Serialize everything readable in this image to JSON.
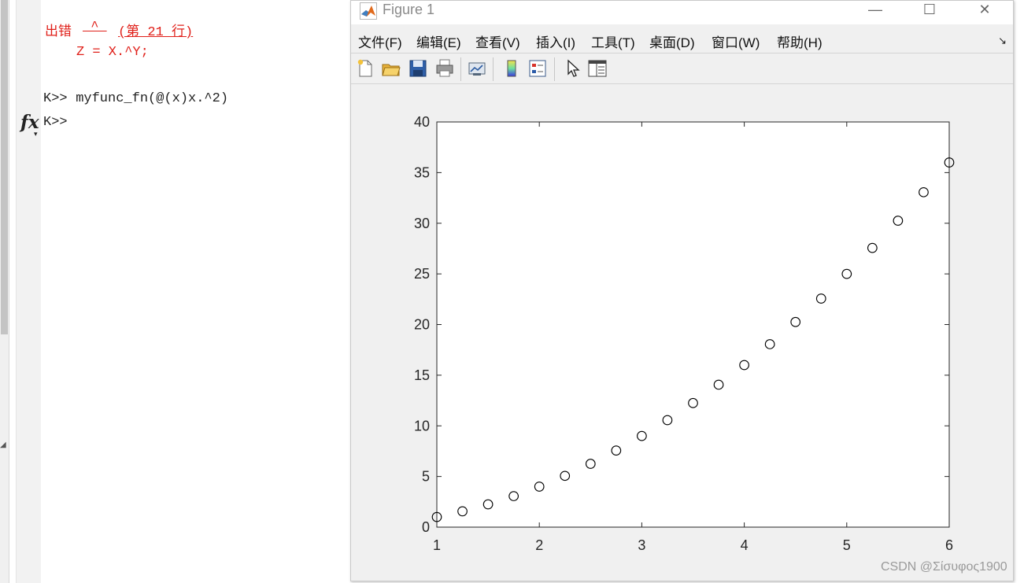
{
  "command_window": {
    "error_prefix": "出错",
    "error_caret": " ^ ",
    "error_location": "(第 21 行)",
    "error_code_line": "Z = X.^Y;",
    "prompt1": "K>>",
    "command1": " myfunc_fn(@(x)x.^2)",
    "prompt2": "K>>",
    "fx_label": "fx"
  },
  "figure": {
    "title": "Figure 1",
    "window_buttons": {
      "minimize": "—",
      "maximize": "☐",
      "close": "✕"
    },
    "menu": [
      "文件(F)",
      "编辑(E)",
      "查看(V)",
      "插入(I)",
      "工具(T)",
      "桌面(D)",
      "窗口(W)",
      "帮助(H)"
    ],
    "dock_arrow": "↘",
    "toolbar_icons": [
      "new-figure-icon",
      "open-file-icon",
      "save-icon",
      "print-icon",
      "link-plot-icon",
      "colorbar-icon",
      "legend-icon",
      "edit-plot-pointer-icon",
      "property-inspector-icon"
    ]
  },
  "chart_data": {
    "type": "scatter",
    "marker": "circle-open",
    "marker_color": "#000000",
    "x": [
      1,
      1.25,
      1.5,
      1.75,
      2,
      2.25,
      2.5,
      2.75,
      3,
      3.25,
      3.5,
      3.75,
      4,
      4.25,
      4.5,
      4.75,
      5,
      5.25,
      5.5,
      5.75,
      6
    ],
    "y": [
      1,
      1.5625,
      2.25,
      3.0625,
      4,
      5.0625,
      6.25,
      7.5625,
      9,
      10.5625,
      12.25,
      14.0625,
      16,
      18.0625,
      20.25,
      22.5625,
      25,
      27.5625,
      30.25,
      33.0625,
      36
    ],
    "xlim": [
      1,
      6
    ],
    "ylim": [
      0,
      40
    ],
    "xticks": [
      1,
      2,
      3,
      4,
      5,
      6
    ],
    "yticks": [
      0,
      5,
      10,
      15,
      20,
      25,
      30,
      35,
      40
    ],
    "title": "",
    "xlabel": "",
    "ylabel": "",
    "grid": false,
    "box": true
  },
  "watermark": "CSDN @Σίσυφος1900"
}
